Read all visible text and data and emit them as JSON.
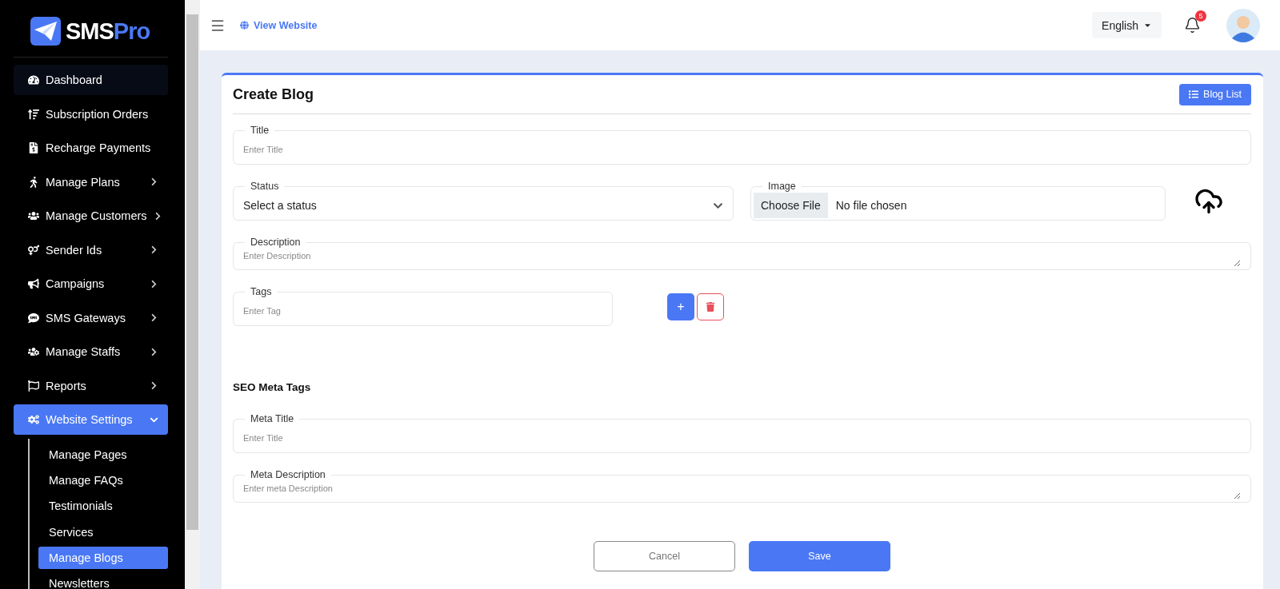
{
  "brand": {
    "name": "SMS",
    "accent": "Pro"
  },
  "sidebar": {
    "items": [
      {
        "kind": "link",
        "label": "Dashboard",
        "hovered": true,
        "selected": false
      },
      {
        "kind": "link",
        "label": "Subscription Orders",
        "hovered": false,
        "selected": false
      },
      {
        "kind": "link",
        "label": "Recharge Payments",
        "hovered": false,
        "selected": false
      },
      {
        "kind": "group",
        "label": "Manage Plans",
        "hovered": false,
        "selected": false,
        "expanded": false
      },
      {
        "kind": "group",
        "label": "Manage Customers",
        "hovered": false,
        "selected": false,
        "expanded": false
      },
      {
        "kind": "group",
        "label": "Sender Ids",
        "hovered": false,
        "selected": false,
        "expanded": false
      },
      {
        "kind": "group",
        "label": "Campaigns",
        "hovered": false,
        "selected": false,
        "expanded": false
      },
      {
        "kind": "group",
        "label": "SMS Gateways",
        "hovered": false,
        "selected": false,
        "expanded": false
      },
      {
        "kind": "group",
        "label": "Manage Staffs",
        "hovered": false,
        "selected": false,
        "expanded": false
      },
      {
        "kind": "group",
        "label": "Reports",
        "hovered": false,
        "selected": false,
        "expanded": false
      },
      {
        "kind": "group",
        "label": "Website Settings",
        "hovered": false,
        "selected": true,
        "expanded": true,
        "children": [
          {
            "label": "Manage Pages",
            "selected": false
          },
          {
            "label": "Manage FAQs",
            "selected": false
          },
          {
            "label": "Testimonials",
            "selected": false
          },
          {
            "label": "Services",
            "selected": false
          },
          {
            "label": "Manage Blogs",
            "selected": true
          },
          {
            "label": "Newsletters",
            "selected": false
          }
        ]
      }
    ]
  },
  "header": {
    "view_website": "View Website",
    "language": "English",
    "notifications": "5"
  },
  "card": {
    "title": "Create Blog",
    "list_button": "Blog List",
    "fields": [
      {
        "kind": "text",
        "label": "Title",
        "placeholder": "Enter Title"
      },
      {
        "kind": "select",
        "label": "Status",
        "value": "Select a status"
      },
      {
        "kind": "file",
        "label": "Image",
        "button": "Choose File",
        "value": "No file chosen"
      },
      {
        "kind": "textarea",
        "label": "Description",
        "placeholder": "Enter Description"
      },
      {
        "kind": "tag",
        "label": "Tags",
        "placeholder": "Enter Tag"
      },
      {
        "kind": "heading",
        "label": "SEO Meta Tags"
      },
      {
        "kind": "text",
        "label": "Meta Title",
        "placeholder": "Enter Title"
      },
      {
        "kind": "textarea",
        "label": "Meta Description",
        "placeholder": "Enter meta Description"
      }
    ],
    "add_button": "+",
    "cancel": "Cancel",
    "save": "Save"
  }
}
